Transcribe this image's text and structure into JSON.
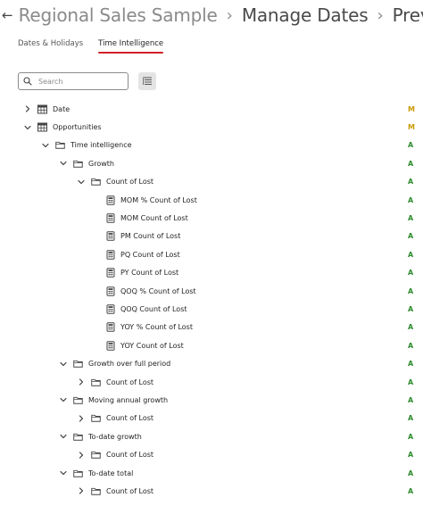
{
  "header": {
    "back_glyph": "←",
    "app_icon": "calendar-function-icon",
    "crumbs": [
      "Regional Sales Sample",
      "Manage Dates",
      "Prev"
    ]
  },
  "tabs": [
    {
      "label": "Dates & Holidays",
      "active": false
    },
    {
      "label": "Time Intelligence",
      "active": true
    }
  ],
  "search": {
    "placeholder": "Search",
    "value": ""
  },
  "filter_button": {
    "icon": "filter-list-icon"
  },
  "colors": {
    "accent": "#d0202a",
    "status_m": "#c99a00",
    "status_a": "#2e8b2e"
  },
  "tree": [
    {
      "label": "Date",
      "level": 0,
      "chevron": "collapsed",
      "icon": "table",
      "status": "M"
    },
    {
      "label": "Opportunities",
      "level": 0,
      "chevron": "expanded",
      "icon": "table",
      "status": "M"
    },
    {
      "label": "Time intelligence",
      "level": 1,
      "chevron": "expanded",
      "icon": "folder",
      "status": "A"
    },
    {
      "label": "Growth",
      "level": 2,
      "chevron": "expanded",
      "icon": "folder",
      "status": "A"
    },
    {
      "label": "Count of Lost",
      "level": 3,
      "chevron": "expanded",
      "icon": "folder",
      "status": "A"
    },
    {
      "label": "MOM % Count of Lost",
      "level": 4,
      "chevron": "none",
      "icon": "measure",
      "status": "A"
    },
    {
      "label": "MOM Count of Lost",
      "level": 4,
      "chevron": "none",
      "icon": "measure",
      "status": "A"
    },
    {
      "label": "PM Count of Lost",
      "level": 4,
      "chevron": "none",
      "icon": "measure",
      "status": "A"
    },
    {
      "label": "PQ Count of Lost",
      "level": 4,
      "chevron": "none",
      "icon": "measure",
      "status": "A"
    },
    {
      "label": "PY Count of Lost",
      "level": 4,
      "chevron": "none",
      "icon": "measure",
      "status": "A"
    },
    {
      "label": "QOQ % Count of Lost",
      "level": 4,
      "chevron": "none",
      "icon": "measure",
      "status": "A"
    },
    {
      "label": "QOQ Count of Lost",
      "level": 4,
      "chevron": "none",
      "icon": "measure",
      "status": "A"
    },
    {
      "label": "YOY % Count of Lost",
      "level": 4,
      "chevron": "none",
      "icon": "measure",
      "status": "A"
    },
    {
      "label": "YOY Count of Lost",
      "level": 4,
      "chevron": "none",
      "icon": "measure",
      "status": "A"
    },
    {
      "label": "Growth over full period",
      "level": 2,
      "chevron": "expanded",
      "icon": "folder",
      "status": "A"
    },
    {
      "label": "Count of Lost",
      "level": 3,
      "chevron": "collapsed",
      "icon": "folder",
      "status": "A"
    },
    {
      "label": "Moving annual growth",
      "level": 2,
      "chevron": "expanded",
      "icon": "folder",
      "status": "A"
    },
    {
      "label": "Count of Lost",
      "level": 3,
      "chevron": "collapsed",
      "icon": "folder",
      "status": "A"
    },
    {
      "label": "To-date growth",
      "level": 2,
      "chevron": "expanded",
      "icon": "folder",
      "status": "A"
    },
    {
      "label": "Count of Lost",
      "level": 3,
      "chevron": "collapsed",
      "icon": "folder",
      "status": "A"
    },
    {
      "label": "To-date total",
      "level": 2,
      "chevron": "expanded",
      "icon": "folder",
      "status": "A"
    },
    {
      "label": "Count of Lost",
      "level": 3,
      "chevron": "collapsed",
      "icon": "folder",
      "status": "A"
    }
  ]
}
